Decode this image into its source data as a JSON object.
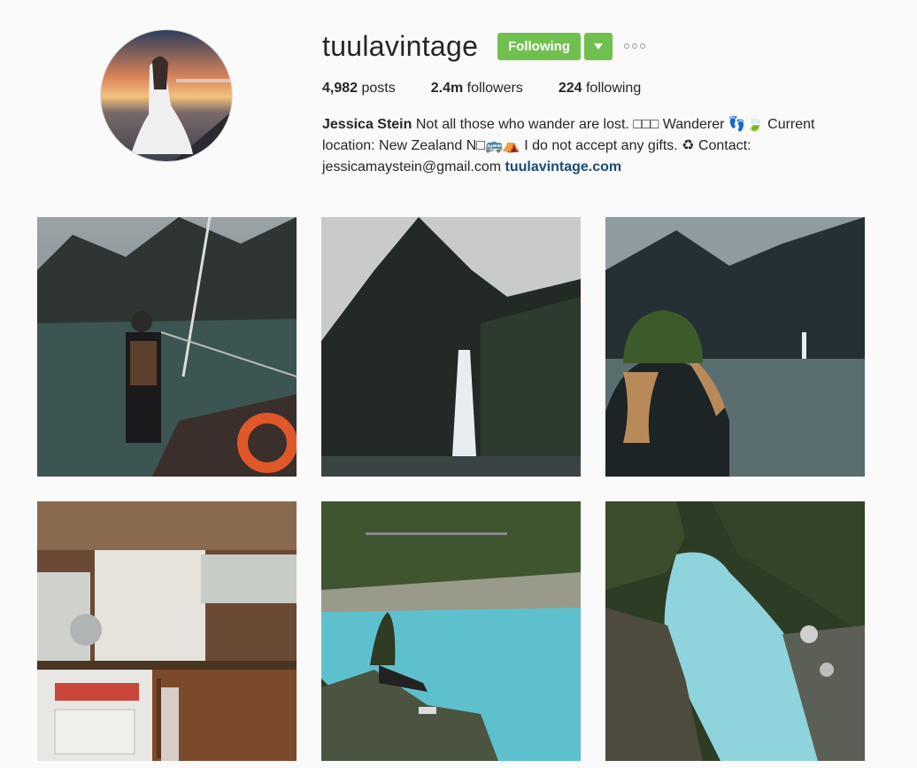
{
  "profile": {
    "username": "tuulavintage",
    "follow_label": "Following",
    "stats": {
      "posts_value": "4,982",
      "posts_label": "posts",
      "followers_value": "2.4m",
      "followers_label": "followers",
      "following_value": "224",
      "following_label": "following"
    },
    "bio": {
      "full_name": "Jessica Stein",
      "text": "Not all those who wander are lost. □□□ Wanderer 👣🍃 Current location: New Zealand N□🚌⛺ I do not accept any gifts. ♻ Contact: jessicamaystein@gmail.com",
      "website": "tuulavintage.com"
    }
  },
  "posts": [
    {
      "name": "post-boat-fjord"
    },
    {
      "name": "post-waterfall-mountain"
    },
    {
      "name": "post-green-beanie"
    },
    {
      "name": "post-van-kitchen"
    },
    {
      "name": "post-river-rock"
    },
    {
      "name": "post-turquoise-river"
    }
  ],
  "colors": {
    "follow_green": "#70c050",
    "link_blue": "#1b4a7a"
  }
}
